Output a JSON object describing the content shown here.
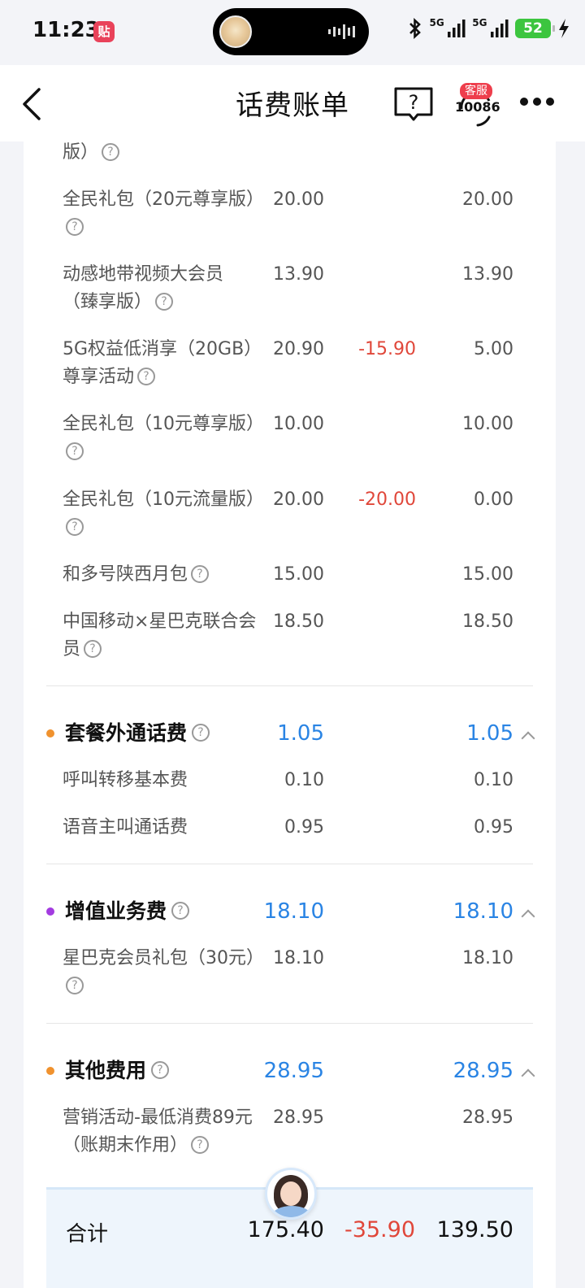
{
  "status_bar": {
    "time": "11:23",
    "app_badge": "贴",
    "network1": "5G",
    "network2": "5G",
    "battery": "52"
  },
  "nav": {
    "title": "话费账单",
    "help_icon": "question-book-icon",
    "service_badge": "客服",
    "service_number": "10086"
  },
  "items_top": [
    {
      "name": "版）",
      "base": "",
      "discount": "",
      "actual": "",
      "help": true
    },
    {
      "name": "全民礼包（20元尊享版）",
      "base": "20.00",
      "discount": "",
      "actual": "20.00",
      "help": true
    },
    {
      "name": "动感地带视频大会员（臻享版）",
      "base": "13.90",
      "discount": "",
      "actual": "13.90",
      "help": true
    },
    {
      "name": "5G权益低消享（20GB）尊享活动",
      "base": "20.90",
      "discount": "-15.90",
      "actual": "5.00",
      "help": true
    },
    {
      "name": "全民礼包（10元尊享版）",
      "base": "10.00",
      "discount": "",
      "actual": "10.00",
      "help": true
    },
    {
      "name": "全民礼包（10元流量版）",
      "base": "20.00",
      "discount": "-20.00",
      "actual": "0.00",
      "help": true
    },
    {
      "name": "和多号陕西月包",
      "base": "15.00",
      "discount": "",
      "actual": "15.00",
      "help": true
    },
    {
      "name": "中国移动×星巴克联合会员",
      "base": "18.50",
      "discount": "",
      "actual": "18.50",
      "help": true
    }
  ],
  "categories": [
    {
      "name": "套餐外通话费",
      "base": "1.05",
      "actual": "1.05",
      "dot_color": "#f0922e",
      "items": [
        {
          "name": "呼叫转移基本费",
          "base": "0.10",
          "actual": "0.10"
        },
        {
          "name": "语音主叫通话费",
          "base": "0.95",
          "actual": "0.95"
        }
      ]
    },
    {
      "name": "增值业务费",
      "base": "18.10",
      "actual": "18.10",
      "dot_color": "#a33be0",
      "items": [
        {
          "name": "星巴克会员礼包（30元）",
          "base": "18.10",
          "actual": "18.10",
          "help": true
        }
      ]
    },
    {
      "name": "其他费用",
      "base": "28.95",
      "actual": "28.95",
      "dot_color": "#f0922e",
      "items": [
        {
          "name": "营销活动-最低消费89元（账期末作用）",
          "base": "28.95",
          "actual": "28.95",
          "help": true
        }
      ]
    }
  ],
  "total": {
    "label": "合计",
    "base": "175.40",
    "discount": "-35.90",
    "actual": "139.50"
  },
  "colors": {
    "value_blue": "#2a84e4",
    "discount_red": "#e0473a"
  }
}
